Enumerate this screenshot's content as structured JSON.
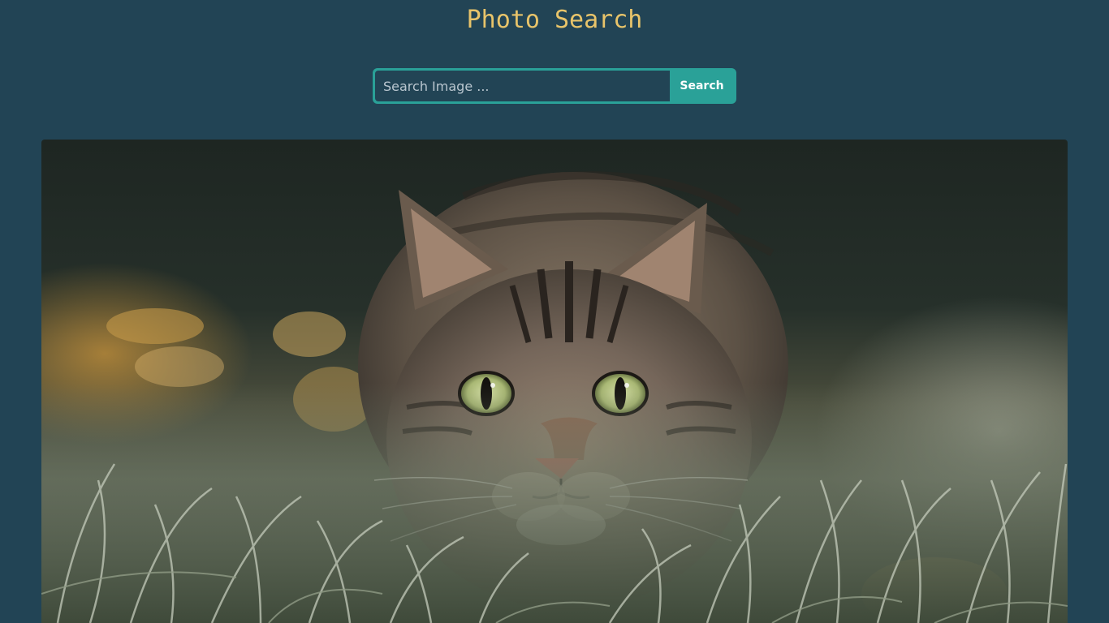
{
  "header": {
    "title": "Photo Search"
  },
  "search": {
    "placeholder": "Search Image ...",
    "value": "",
    "button_label": "Search"
  },
  "results": {
    "photos": [
      {
        "subject": "tabby cat crouching in frosty grass"
      }
    ]
  },
  "colors": {
    "background": "#224455",
    "title": "#e8c46a",
    "accent": "#2aa198",
    "button_text": "#ffffff"
  }
}
